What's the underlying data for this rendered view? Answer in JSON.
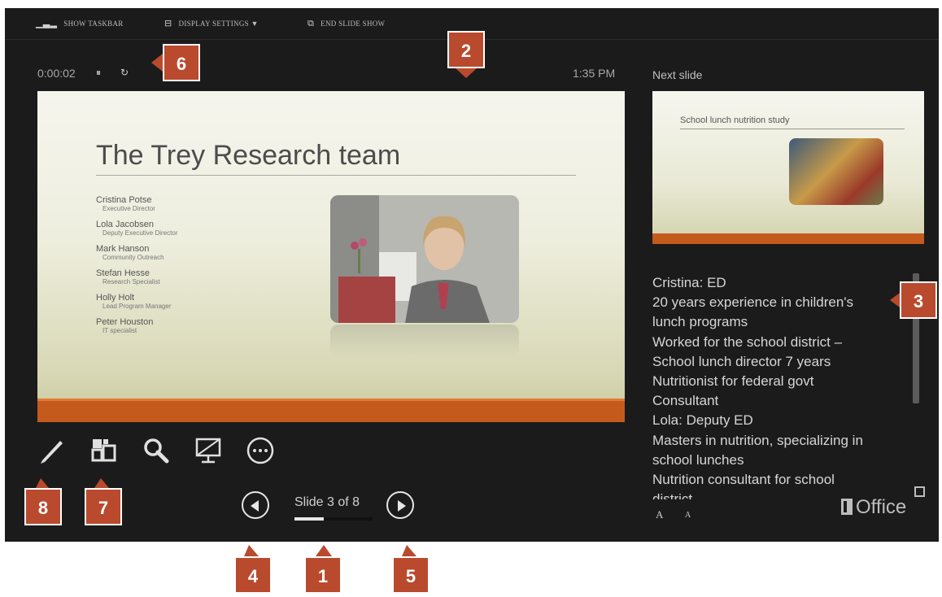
{
  "toolbar": {
    "show_taskbar": "SHOW TASKBAR",
    "display_settings": "DISPLAY SETTINGS ▼",
    "end_slide_show": "END SLIDE SHOW"
  },
  "presenter": {
    "timer": "0:00:02",
    "pause_glyph": "⏸",
    "restart_glyph": "↻",
    "clock": "1:35 PM",
    "next_slide_label": "Next slide"
  },
  "current_slide": {
    "title": "The Trey Research team",
    "members": [
      {
        "name": "Cristina Potse",
        "role": "Executive Director"
      },
      {
        "name": "Lola Jacobsen",
        "role": "Deputy Executive Director"
      },
      {
        "name": "Mark Hanson",
        "role": "Community Outreach"
      },
      {
        "name": "Stefan Hesse",
        "role": "Research Specialist"
      },
      {
        "name": "Holly Holt",
        "role": "Lead Program Manager"
      },
      {
        "name": "Peter Houston",
        "role": "IT specialist"
      }
    ]
  },
  "next_slide": {
    "title": "School lunch nutrition study"
  },
  "notes": {
    "lines": [
      "Cristina: ED",
      "20 years experience in children's",
      "lunch programs",
      "Worked for the school district –",
      "School lunch director 7 years",
      "Nutritionist for federal govt",
      "Consultant",
      "Lola: Deputy ED",
      "Masters in nutrition, specializing in",
      "school lunches",
      "Nutrition consultant for school",
      "district"
    ],
    "increase_font": "A",
    "decrease_font": "A"
  },
  "tools": [
    "pen-tool",
    "see-all-slides",
    "zoom",
    "black-screen",
    "more-options"
  ],
  "navigation": {
    "counter": "Slide 3 of 8",
    "current": 3,
    "total": 8
  },
  "office_logo": "Office",
  "callouts": [
    "1",
    "2",
    "3",
    "4",
    "5",
    "6",
    "7",
    "8"
  ],
  "colors": {
    "background": "#1b1b1b",
    "accent_bar": "#c55a1d",
    "callout": "#b94a2e"
  },
  "icons": {
    "taskbar": "bar-chart-icon",
    "display_settings": "monitor-settings-icon",
    "end_show": "end-show-icon",
    "pen": "pen-icon",
    "slides": "slide-grid-icon",
    "zoom": "magnifier-icon",
    "black_screen": "projector-off-icon",
    "more": "ellipsis-icon",
    "previous": "chevron-left-icon",
    "next": "chevron-right-icon"
  }
}
